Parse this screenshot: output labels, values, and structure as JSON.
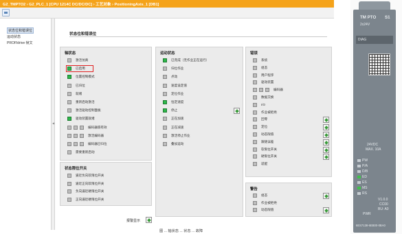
{
  "titlebar": {
    "breadcrumb": "G2_TMPTO2 › G2_PLC_1 [CPU 1214C DC/DC/DC] › 工艺对象 › PositioningAxis_1 [DB1]"
  },
  "toolbar": {
    "icon": "diagnostics-view-icon"
  },
  "sidebar": {
    "items": [
      {
        "label": "状态位和错误位",
        "active": true
      },
      {
        "label": "运动状态",
        "active": false
      },
      {
        "label": "PROFIdrive 帧文",
        "active": false
      }
    ]
  },
  "panel": {
    "title": "状态位和错误位"
  },
  "axis_status": {
    "title": "轴状态",
    "rows": [
      {
        "label": "激活仿真",
        "led": "off"
      },
      {
        "label": "已启用",
        "led": "on",
        "highlighted": true
      },
      {
        "label": "位置控制模式",
        "led": "on"
      },
      {
        "label": "已归位",
        "led": "off"
      },
      {
        "label": "就绪",
        "led": "off"
      },
      {
        "label": "重新启动激活",
        "led": "off"
      },
      {
        "label": "激活驱动控制面板",
        "led": "off"
      },
      {
        "label": "驱动装置就绪",
        "led": "on"
      },
      {
        "label": "编码器值有效",
        "led": "off",
        "multi": 3
      },
      {
        "label": "激活编码器",
        "led": "off",
        "multi": 3
      },
      {
        "label": "编码器已归位",
        "led": "off",
        "multi": 3
      },
      {
        "label": "需要重新启动",
        "led": "off"
      }
    ]
  },
  "limit_switch": {
    "title": "状态限位开关",
    "rows": [
      {
        "label": "逼近负向软限位开关",
        "led": "off"
      },
      {
        "label": "逼近正向软限位开关",
        "led": "off"
      },
      {
        "label": "负向逼近硬限位开关",
        "led": "off"
      },
      {
        "label": "正向逼近硬限位开关",
        "led": "off"
      }
    ]
  },
  "motion_status": {
    "title": "运动状态",
    "rows": [
      {
        "label": "已完成（无作业正在运行）",
        "led": "on"
      },
      {
        "label": "归位作业",
        "led": "off"
      },
      {
        "label": "点动",
        "led": "off"
      },
      {
        "label": "速度设定值",
        "led": "off"
      },
      {
        "label": "定位作业",
        "led": "off"
      },
      {
        "label": "恒定速度",
        "led": "on"
      },
      {
        "label": "停止",
        "led": "on",
        "button": true
      },
      {
        "label": "正在加速",
        "led": "off"
      },
      {
        "label": "正在减速",
        "led": "off"
      },
      {
        "label": "激活停止作业",
        "led": "off"
      },
      {
        "label": "叠加运动",
        "led": "off"
      }
    ]
  },
  "errors": {
    "title": "错误",
    "rows": [
      {
        "label": "系统",
        "led": "off"
      },
      {
        "label": "组态",
        "led": "off"
      },
      {
        "label": "用户程序",
        "led": "off"
      },
      {
        "label": "驱动装置",
        "led": "off"
      },
      {
        "label": "编码器",
        "led": "off",
        "multi": 3
      },
      {
        "label": "数据交换",
        "led": "off"
      },
      {
        "label": "I/O",
        "led": "off"
      },
      {
        "label": "作业被拒绝",
        "led": "off"
      },
      {
        "label": "回零",
        "led": "off",
        "button": true
      },
      {
        "label": "定位",
        "led": "off",
        "button": true
      },
      {
        "label": "动态限值",
        "led": "off",
        "button": true
      },
      {
        "label": "跟随误差",
        "led": "off",
        "button": true
      },
      {
        "label": "软限位开关",
        "led": "off",
        "button": true
      },
      {
        "label": "硬限位开关",
        "led": "off",
        "button": true
      },
      {
        "label": "适配",
        "led": "off"
      }
    ]
  },
  "warnings": {
    "title": "警告",
    "rows": [
      {
        "label": "组态",
        "led": "off",
        "button": true
      },
      {
        "label": "作业被拒绝",
        "led": "off"
      },
      {
        "label": "动态限值",
        "led": "off",
        "button": true
      }
    ]
  },
  "alarm_display": {
    "label": "报警显示"
  },
  "caption": "图 ... 轴状态 ... 状态 ... 故障",
  "module": {
    "model": "TM PTO",
    "channels": "S1",
    "supply": "2x24V",
    "diag": "DIAG",
    "rating1": "24VDC",
    "rating2": "MAX. 10A",
    "version": "V1.0.0",
    "code": "CC00",
    "bu": "BU: A0",
    "pwr": "PWR",
    "article": "6ES7138-6EB00-0BA0",
    "led_labels": [
      "PW",
      "P/A",
      "D/B",
      "ED",
      "ES",
      "MS",
      "RS"
    ],
    "led_green": [
      false,
      false,
      false,
      true,
      false,
      true,
      false
    ]
  }
}
